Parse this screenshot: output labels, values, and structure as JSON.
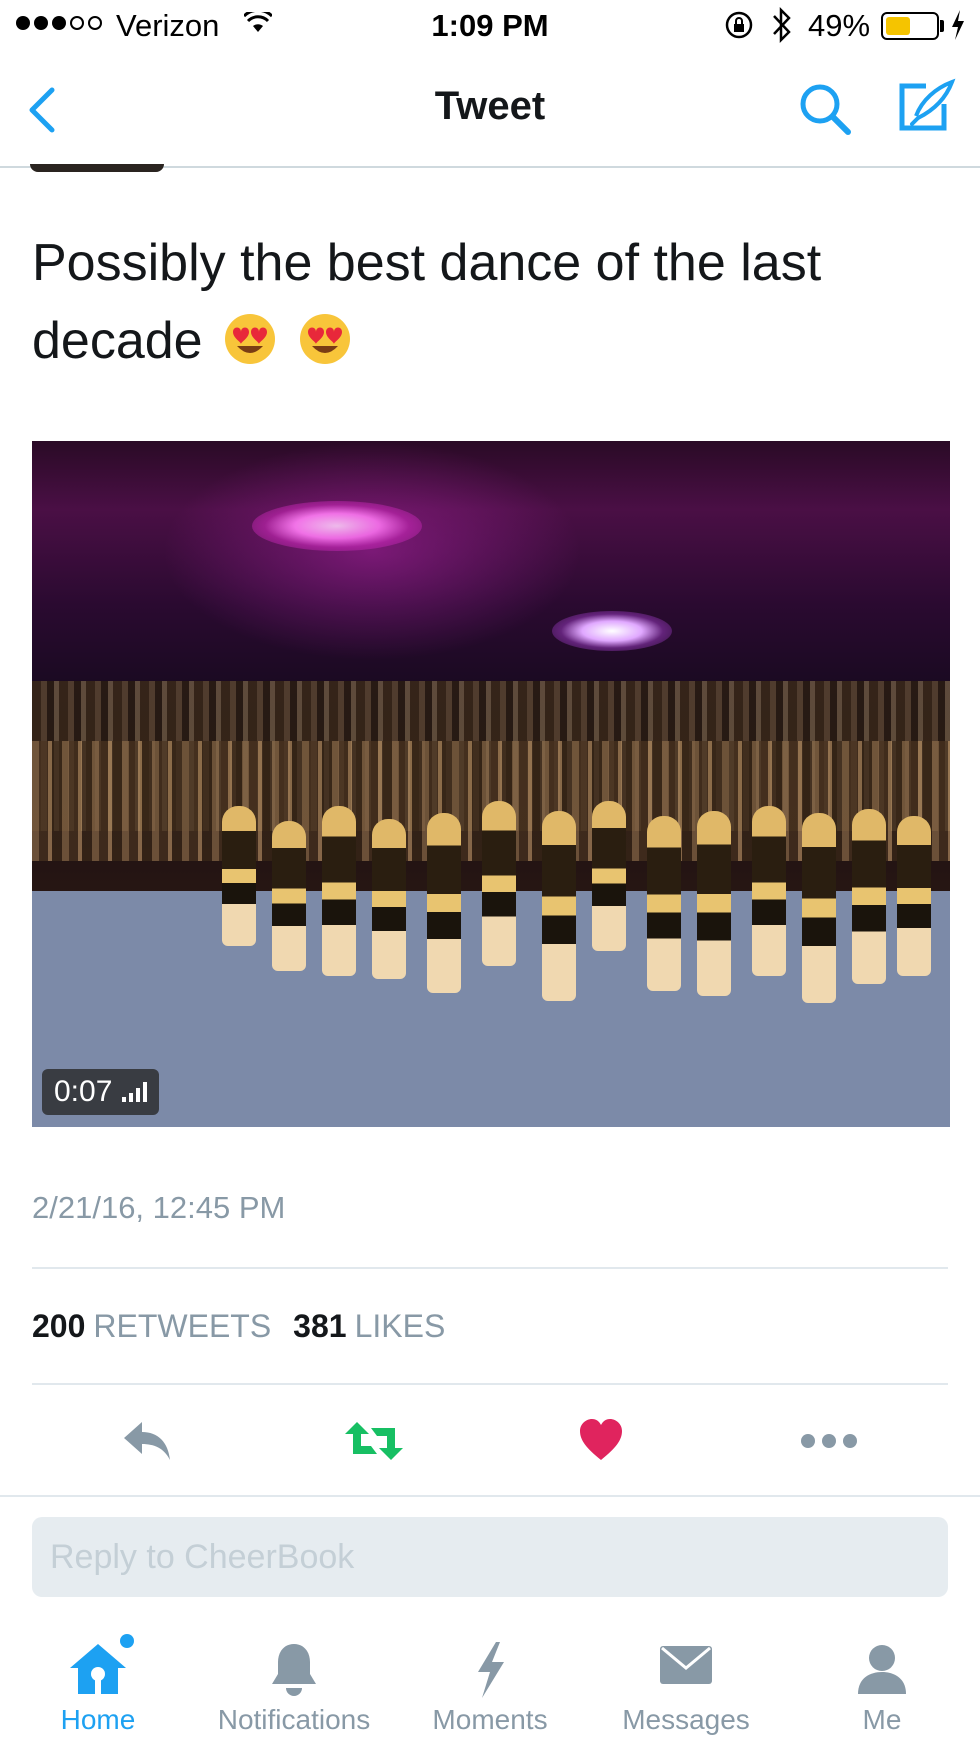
{
  "status_bar": {
    "carrier": "Verizon",
    "time": "1:09 PM",
    "battery_percent": "49%",
    "battery_level": 0.49,
    "battery_color": "#f5c400",
    "signal_strength": 3,
    "icons": [
      "wifi-icon",
      "orientation-lock-icon",
      "bluetooth-icon",
      "charging-bolt-icon"
    ]
  },
  "nav": {
    "title": "Tweet",
    "back_icon": "chevron-left-icon",
    "search_icon": "search-icon",
    "compose_icon": "compose-icon"
  },
  "tweet": {
    "text": "Possibly the best dance of the last decade",
    "emojis": [
      "heart-eyes-emoji",
      "heart-eyes-emoji"
    ],
    "timestamp": "2/21/16, 12:45 PM"
  },
  "video": {
    "duration": "0:07",
    "volume_icon": "signal-bars-icon"
  },
  "stats": {
    "retweets_count": "200",
    "retweets_label": "RETWEETS",
    "likes_count": "381",
    "likes_label": "LIKES"
  },
  "actions": {
    "reply_icon": "reply-icon",
    "retweet_icon": "retweet-icon",
    "like_icon": "heart-icon",
    "more_icon": "more-dots-icon",
    "retweet_color": "#17bf63",
    "like_color": "#e0245e",
    "neutral_color": "#8899a6"
  },
  "reply": {
    "placeholder": "Reply to CheerBook"
  },
  "tabbar": {
    "active_color": "#1da1f2",
    "inactive_color": "#8899a6",
    "items": [
      {
        "label": "Home",
        "icon": "home-icon",
        "active": true
      },
      {
        "label": "Notifications",
        "icon": "bell-icon",
        "active": false
      },
      {
        "label": "Moments",
        "icon": "lightning-icon",
        "active": false
      },
      {
        "label": "Messages",
        "icon": "envelope-icon",
        "active": false
      },
      {
        "label": "Me",
        "icon": "person-icon",
        "active": false
      }
    ]
  },
  "colors": {
    "accent": "#1da1f2",
    "text_primary": "#14171a",
    "text_secondary": "#8899a6",
    "divider": "#e1e8ed"
  }
}
